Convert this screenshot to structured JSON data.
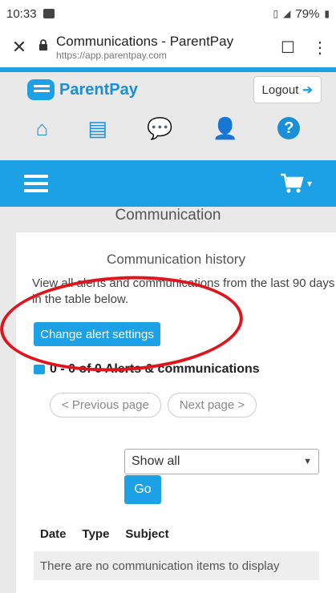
{
  "status_bar": {
    "time": "10:33",
    "battery": "79%"
  },
  "browser": {
    "title": "Communications - ParentPay",
    "url": "https://app.parentpay.com",
    "close_icon": "close-icon",
    "bookmark_icon": "bookmark-icon",
    "menu_icon": "more-vertical-icon"
  },
  "header": {
    "brand": "ParentPay",
    "logout_label": "Logout"
  },
  "nav_icons": [
    "home-icon",
    "payments-icon",
    "chat-icon",
    "profile-icon",
    "help-icon"
  ],
  "menu_bar": {
    "hamburger_icon": "hamburger-icon",
    "cart_icon": "cart-icon"
  },
  "page": {
    "section_title": "Communication",
    "card_title": "Communication history",
    "description": "View all alerts and communications from the last 90 days in the table below.",
    "change_alert_settings": "Change alert settings",
    "count_text": "0 - 0 of 0 Alerts & communications",
    "prev_page": "< Previous page",
    "next_page": "Next page >",
    "filter_selected": "Show all",
    "go_label": "Go",
    "columns": [
      "Date",
      "Type",
      "Subject"
    ],
    "empty_message": "There are no communication items to display"
  },
  "colors": {
    "accent": "#1da1e6",
    "brand_text": "#1a8ed6",
    "annotation": "#e0141c"
  }
}
